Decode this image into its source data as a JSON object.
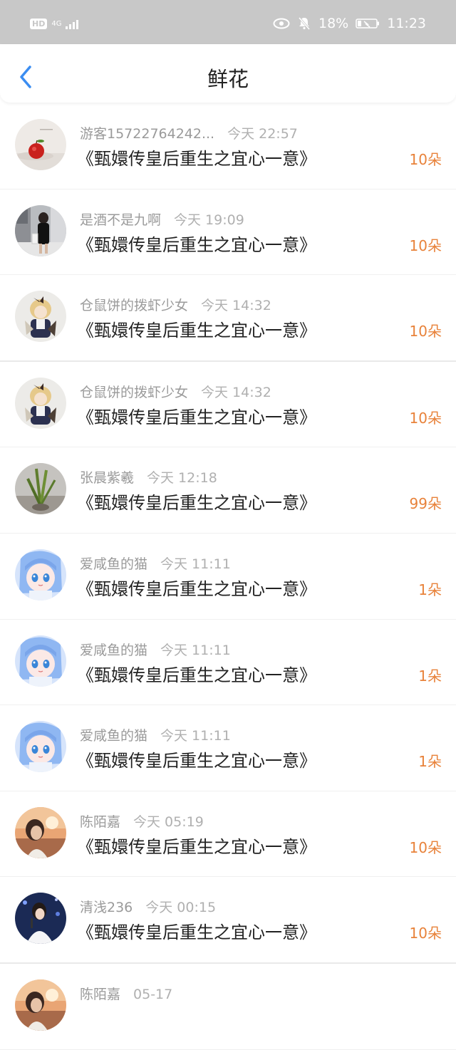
{
  "status_bar": {
    "hd": "HD",
    "network": "4G",
    "battery": "18%",
    "time": "11:23"
  },
  "header": {
    "title": "鲜花"
  },
  "colors": {
    "accent_blue": "#3b8df1",
    "flower_orange": "#e8823a",
    "status_bg": "#c8c8c8"
  },
  "entries": [
    {
      "user": "游客15722764242...",
      "time": "今天 22:57",
      "book": "《甄嬛传皇后重生之宜心一意》",
      "count": "10朵",
      "avatar": "apple"
    },
    {
      "user": "是酒不是九啊",
      "time": "今天 19:09",
      "book": "《甄嬛传皇后重生之宜心一意》",
      "count": "10朵",
      "avatar": "street"
    },
    {
      "user": "仓鼠饼的拨虾少女",
      "time": "今天 14:32",
      "book": "《甄嬛传皇后重生之宜心一意》",
      "count": "10朵",
      "avatar": "doll"
    },
    {
      "user": "仓鼠饼的拨虾少女",
      "time": "今天 14:32",
      "book": "《甄嬛传皇后重生之宜心一意》",
      "count": "10朵",
      "avatar": "doll"
    },
    {
      "user": "张晨紫羲",
      "time": "今天 12:18",
      "book": "《甄嬛传皇后重生之宜心一意》",
      "count": "99朵",
      "avatar": "plant"
    },
    {
      "user": "爱咸鱼的猫",
      "time": "今天 11:11",
      "book": "《甄嬛传皇后重生之宜心一意》",
      "count": "1朵",
      "avatar": "anime"
    },
    {
      "user": "爱咸鱼的猫",
      "time": "今天 11:11",
      "book": "《甄嬛传皇后重生之宜心一意》",
      "count": "1朵",
      "avatar": "anime"
    },
    {
      "user": "爱咸鱼的猫",
      "time": "今天 11:11",
      "book": "《甄嬛传皇后重生之宜心一意》",
      "count": "1朵",
      "avatar": "anime"
    },
    {
      "user": "陈陌嘉",
      "time": "今天 05:19",
      "book": "《甄嬛传皇后重生之宜心一意》",
      "count": "10朵",
      "avatar": "sunset"
    },
    {
      "user": "清浅236",
      "time": "今天 00:15",
      "book": "《甄嬛传皇后重生之宜心一意》",
      "count": "10朵",
      "avatar": "singer"
    },
    {
      "user": "陈陌嘉",
      "time": "05-17",
      "book": "",
      "count": "",
      "avatar": "sunset"
    }
  ]
}
